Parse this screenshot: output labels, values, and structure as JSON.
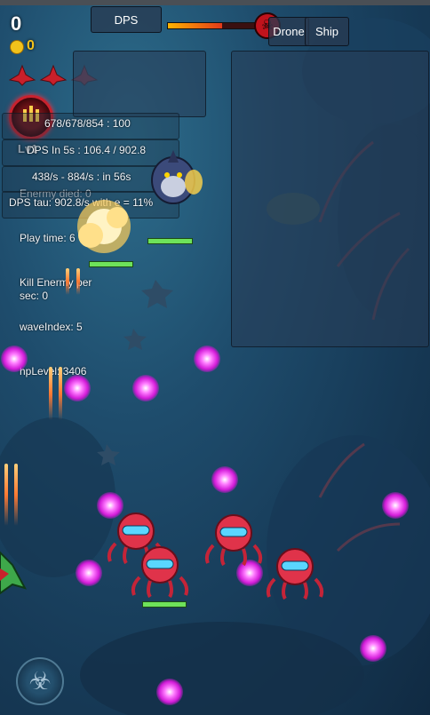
{
  "hud": {
    "score": "0",
    "coins": "0",
    "lives": [
      "ship-life-icon",
      "ship-life-icon",
      "ship-life-icon"
    ]
  },
  "top_buttons": {
    "dps": "DPS",
    "drone": "Drone",
    "ship": "Ship"
  },
  "boss_progress": 0.55,
  "stats": {
    "hp_line": "678/678/854 : 100",
    "dps5s": "DPS In 5s : 106.4 / 902.8",
    "rate": "438/s - 884/s : in 56s",
    "enemy_died": "Enermy died: 0",
    "dps_tau": "DPS tau: 902.8/s with e = 11%",
    "play_time": "Play time: 6",
    "kill_per_sec_1": "Kill Enermy per",
    "kill_per_sec_2": "sec: 0",
    "wave_index": "waveIndex: 5",
    "hp_level": "hpLevel: 3406",
    "lvl_label": "Lv1"
  },
  "colors": {
    "hp_bar": "#6ee35a",
    "orb": "#d21bd8",
    "coin": "#f2c21b"
  }
}
